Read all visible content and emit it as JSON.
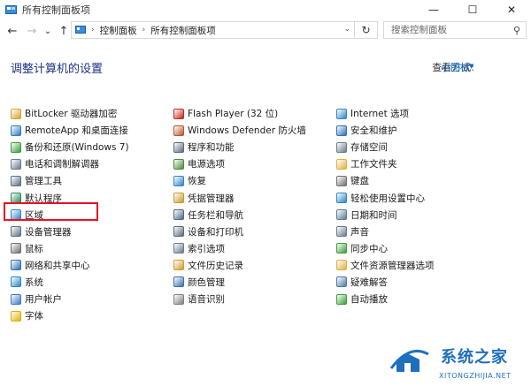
{
  "window": {
    "title": "所有控制面板项",
    "controls": {
      "minimize": "—",
      "maximize": "☐",
      "close": "✕"
    }
  },
  "nav": {
    "back": "←",
    "forward": "→",
    "recent": "⌄",
    "up": "↑",
    "breadcrumbs": [
      "控制面板",
      "所有控制面板项"
    ],
    "refresh": "↻",
    "search_placeholder": "搜索控制面板"
  },
  "header": {
    "title": "调整计算机的设置",
    "view_by_label": "查看方式:",
    "view_by_value": "小图标"
  },
  "columns": [
    [
      {
        "label": "BitLocker 驱动器加密",
        "icon": "bitlocker-icon",
        "color": "#d8a42a"
      },
      {
        "label": "RemoteApp 和桌面连接",
        "icon": "remoteapp-icon",
        "color": "#2f7bc1"
      },
      {
        "label": "备份和还原(Windows 7)",
        "icon": "backup-icon",
        "color": "#3a9d3a"
      },
      {
        "label": "电话和调制解调器",
        "icon": "phone-modem-icon",
        "color": "#6c7a89"
      },
      {
        "label": "管理工具",
        "icon": "admin-tools-icon",
        "color": "#5c6f82"
      },
      {
        "label": "默认程序",
        "icon": "default-programs-icon",
        "color": "#2e8b57"
      },
      {
        "label": "区域",
        "icon": "region-icon",
        "color": "#2f86c8"
      },
      {
        "label": "设备管理器",
        "icon": "device-manager-icon",
        "color": "#607080"
      },
      {
        "label": "鼠标",
        "icon": "mouse-icon",
        "color": "#707070"
      },
      {
        "label": "网络和共享中心",
        "icon": "network-icon",
        "color": "#2f6fb5"
      },
      {
        "label": "系统",
        "icon": "system-icon",
        "color": "#2f86c8"
      },
      {
        "label": "用户帐户",
        "icon": "user-accounts-icon",
        "color": "#3e7cc4"
      },
      {
        "label": "字体",
        "icon": "fonts-icon",
        "color": "#e0b000"
      }
    ],
    [
      {
        "label": "Flash Player (32 位)",
        "icon": "flash-icon",
        "color": "#c0281b"
      },
      {
        "label": "Windows Defender 防火墙",
        "icon": "firewall-icon",
        "color": "#b55a2a"
      },
      {
        "label": "程序和功能",
        "icon": "programs-icon",
        "color": "#5a6b7c"
      },
      {
        "label": "电源选项",
        "icon": "power-icon",
        "color": "#4c8a3c"
      },
      {
        "label": "恢复",
        "icon": "recovery-icon",
        "color": "#2f86c8"
      },
      {
        "label": "凭据管理器",
        "icon": "credential-icon",
        "color": "#c89b2c"
      },
      {
        "label": "任务栏和导航",
        "icon": "taskbar-icon",
        "color": "#4d6a8a"
      },
      {
        "label": "设备和打印机",
        "icon": "printer-icon",
        "color": "#5a6a7a"
      },
      {
        "label": "索引选项",
        "icon": "indexing-icon",
        "color": "#6a7a8a"
      },
      {
        "label": "文件历史记录",
        "icon": "file-history-icon",
        "color": "#d39a2a"
      },
      {
        "label": "颜色管理",
        "icon": "color-management-icon",
        "color": "#3a6fb0"
      },
      {
        "label": "语音识别",
        "icon": "speech-icon",
        "color": "#808080"
      }
    ],
    [
      {
        "label": "Internet 选项",
        "icon": "internet-options-icon",
        "color": "#2f86c8"
      },
      {
        "label": "安全和维护",
        "icon": "security-flag-icon",
        "color": "#2f6fb5"
      },
      {
        "label": "存储空间",
        "icon": "storage-icon",
        "color": "#6a7a8a"
      },
      {
        "label": "工作文件夹",
        "icon": "work-folders-icon",
        "color": "#e0b040"
      },
      {
        "label": "键盘",
        "icon": "keyboard-icon",
        "color": "#707070"
      },
      {
        "label": "轻松使用设置中心",
        "icon": "ease-of-access-icon",
        "color": "#2f86c8"
      },
      {
        "label": "日期和时间",
        "icon": "date-time-icon",
        "color": "#5a7a9a"
      },
      {
        "label": "声音",
        "icon": "sound-icon",
        "color": "#6a7a8a"
      },
      {
        "label": "同步中心",
        "icon": "sync-icon",
        "color": "#3a9d3a"
      },
      {
        "label": "文件资源管理器选项",
        "icon": "explorer-options-icon",
        "color": "#e0b040"
      },
      {
        "label": "疑难解答",
        "icon": "troubleshoot-icon",
        "color": "#4d7aa6"
      },
      {
        "label": "自动播放",
        "icon": "autoplay-icon",
        "color": "#3a9d3a"
      }
    ]
  ],
  "watermark": {
    "text": "系统之家",
    "sub": "XITONGZHIJIA.NET"
  },
  "colors": {
    "heading": "#1e3287",
    "link": "#0066cc",
    "highlight": "#e81123"
  }
}
